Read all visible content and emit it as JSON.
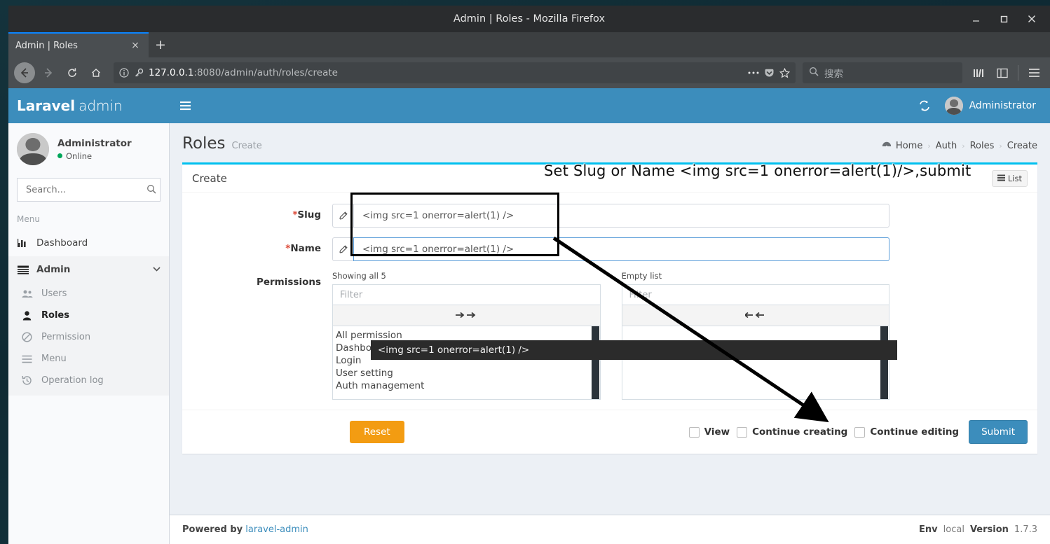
{
  "window": {
    "title": "Admin | Roles - Mozilla Firefox",
    "minimize_label": "minimize-icon",
    "maximize_label": "maximize-icon",
    "close_label": "close-icon"
  },
  "browser": {
    "tab_title": "Admin | Roles",
    "tab_close": "×",
    "new_tab": "+",
    "url_host": "127.0.0.1",
    "url_rest": ":8080/admin/auth/roles/create",
    "search_placeholder": "搜索",
    "back_icon": "back-arrow-icon",
    "forward_icon": "forward-arrow-icon",
    "reload_icon": "reload-icon",
    "home_icon": "home-icon",
    "page_action_icon": "page-actions-icon",
    "pocket_icon": "pocket-icon",
    "bookmark_icon": "star-icon",
    "library_icon": "library-icon",
    "sidebar_icon": "sidebar-icon",
    "menu_icon": "hamburger-menu-icon"
  },
  "navbar": {
    "logo_bold": "Laravel",
    "logo_light": "admin",
    "toggle_icon": "hamburger-icon",
    "refresh_icon": "refresh-icon",
    "user_name": "Administrator"
  },
  "sidebar": {
    "user": {
      "name": "Administrator",
      "status": "Online"
    },
    "search_placeholder": "Search...",
    "menu_header": "Menu",
    "items": [
      {
        "label": "Dashboard",
        "icon": "bar-chart-icon",
        "level": "top"
      },
      {
        "label": "Admin",
        "icon": "admin-bars-icon",
        "level": "top-open"
      },
      {
        "label": "Users",
        "icon": "users-icon",
        "level": "sub"
      },
      {
        "label": "Roles",
        "icon": "user-solid-icon",
        "level": "sub-active"
      },
      {
        "label": "Permission",
        "icon": "ban-icon",
        "level": "sub"
      },
      {
        "label": "Menu",
        "icon": "list-icon",
        "level": "sub"
      },
      {
        "label": "Operation log",
        "icon": "history-icon",
        "level": "sub"
      }
    ]
  },
  "page": {
    "title": "Roles",
    "subtitle": "Create",
    "breadcrumb": [
      "Home",
      "Auth",
      "Roles",
      "Create"
    ],
    "breadcrumb_sep": "›"
  },
  "card": {
    "title": "Create",
    "list_button": "List",
    "list_icon": "list-icon"
  },
  "form": {
    "slug": {
      "label": "Slug",
      "required_mark": "*",
      "value": "<img src=1 onerror=alert(1) />",
      "addon_icon": "pencil-icon"
    },
    "name": {
      "label": "Name",
      "required_mark": "*",
      "value": "<img src=1 onerror=alert(1) />",
      "addon_icon": "pencil-icon"
    },
    "permissions": {
      "label": "Permissions",
      "left": {
        "caption": "Showing all 5",
        "filter_placeholder": "Filter",
        "move_icon": "double-right-arrow-icon",
        "options": [
          "All permission",
          "Dashboard",
          "Login",
          "User setting",
          "Auth management"
        ]
      },
      "right": {
        "caption": "Empty list",
        "filter_placeholder": "Filter",
        "move_icon": "double-left-arrow-icon",
        "options": []
      }
    }
  },
  "actions": {
    "reset": "Reset",
    "submit": "Submit",
    "checkboxes": [
      "View",
      "Continue creating",
      "Continue editing"
    ]
  },
  "autocomplete": {
    "suggestion": "<img src=1 onerror=alert(1) />"
  },
  "annotation": {
    "text": "Set Slug or Name <img src=1 onerror=alert(1)/>,submit"
  },
  "footer": {
    "powered_by": "Powered by",
    "link": "laravel-admin",
    "env_label": "Env",
    "env_value": "local",
    "version_label": "Version",
    "version_value": "1.7.3"
  },
  "colors": {
    "navbar": "#3c8dbc",
    "card_accent": "#00c0ef",
    "submit": "#3c8dbc",
    "reset": "#f39c12",
    "online": "#00a65a",
    "required": "#dd4b39"
  }
}
